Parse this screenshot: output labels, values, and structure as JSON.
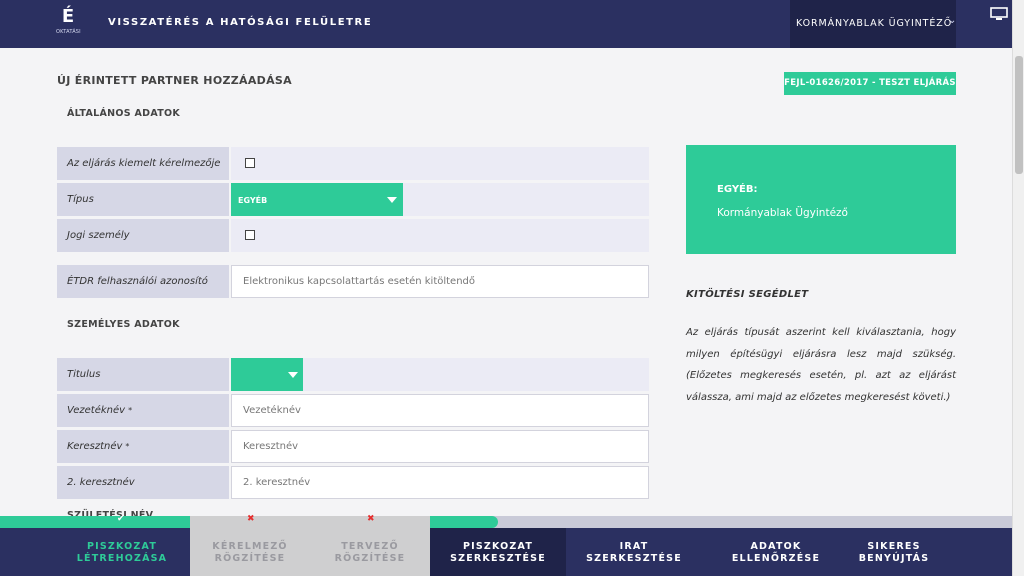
{
  "header": {
    "logo_letter": "É",
    "logo_sub": "OKTATÁSI",
    "title": "VISSZATÉRÉS A HATÓSÁGI FELÜLETRE",
    "user": "KORMÁNYABLAK ÜGYINTÉZŐ",
    "icons": [
      "chevron-down-icon",
      "monitor-icon"
    ]
  },
  "page": {
    "title": "ÚJ ÉRINTETT PARTNER HOZZÁADÁSA",
    "case_badge": "FEJL-01626/2017 - TESZT ELJÁRÁS"
  },
  "general": {
    "title": "ÁLTALÁNOS ADATOK",
    "main_applicant_label": "Az eljárás kiemelt kérelmezője",
    "main_applicant_checked": false,
    "type_label": "Típus",
    "type_value": "EGYÉB",
    "legal_person_label": "Jogi személy",
    "legal_person_checked": false,
    "etdr_label": "ÉTDR felhasználói azonosító",
    "etdr_placeholder": "Elektronikus kapcsolattartás esetén kitöltendő"
  },
  "personal": {
    "title": "SZEMÉLYES ADATOK",
    "titulus_label": "Titulus",
    "titulus_value": "",
    "surname_label": "Vezetéknév",
    "surname_placeholder": "Vezetéknév",
    "firstname_label": "Keresztnév",
    "firstname_placeholder": "Keresztnév",
    "second_firstname_label": "2. keresztnév",
    "second_firstname_placeholder": "2. keresztnév",
    "required_mark": "*",
    "next_section_title": "SZÜLETÉSI NÉV"
  },
  "info_card": {
    "title": "EGYÉB:",
    "subtitle": "Kormányablak Ügyintéző"
  },
  "help": {
    "title": "KITÖLTÉSI SEGÉDLET",
    "text": "Az eljárás típusát aszerint kell kiválasztania, hogy milyen építésügyi eljárásra lesz majd szükség. (Előzetes megkeresés esetén, pl. azt az eljárást válassza, ami majd az előzetes megkeresést követi.)"
  },
  "progress": {
    "ok_mark": "✔",
    "error_mark": "✖"
  },
  "steps": [
    {
      "line1": "PISZKOZAT",
      "line2": "LÉTREHOZÁSA",
      "status": "ok"
    },
    {
      "line1": "KÉRELMEZŐ",
      "line2": "RÖGZÍTÉSE",
      "status": "error"
    },
    {
      "line1": "TERVEZŐ",
      "line2": "RÖGZÍTÉSE",
      "status": "error"
    },
    {
      "line1": "PISZKOZAT",
      "line2": "SZERKESZTÉSE",
      "status": "active"
    },
    {
      "line1": "IRAT",
      "line2": "SZERKESZTÉSE",
      "status": "todo"
    },
    {
      "line1": "ADATOK",
      "line2": "ELLENŐRZÉSE",
      "status": "todo"
    },
    {
      "line1": "SIKERES",
      "line2": "BENYÚJTÁS",
      "status": "todo"
    }
  ],
  "colors": {
    "navy": "#2b3061",
    "navy_dark": "#1f2349",
    "green": "#2ecb98",
    "error_red": "#e53030"
  }
}
